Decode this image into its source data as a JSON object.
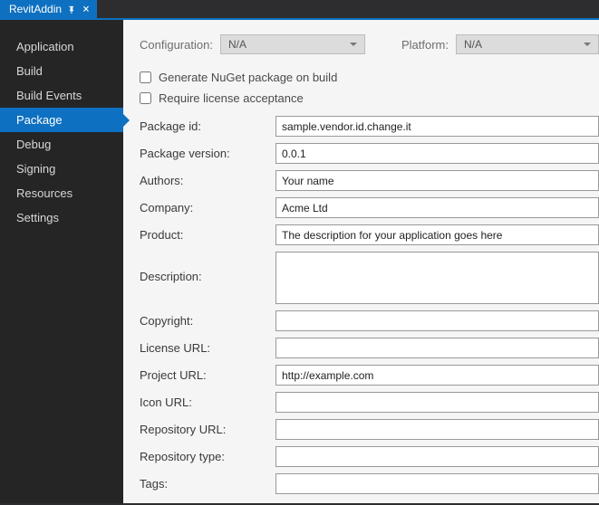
{
  "tab": {
    "title": "RevitAddin"
  },
  "sidebar": {
    "items": [
      {
        "label": "Application",
        "active": false
      },
      {
        "label": "Build",
        "active": false
      },
      {
        "label": "Build Events",
        "active": false
      },
      {
        "label": "Package",
        "active": true
      },
      {
        "label": "Debug",
        "active": false
      },
      {
        "label": "Signing",
        "active": false
      },
      {
        "label": "Resources",
        "active": false
      },
      {
        "label": "Settings",
        "active": false
      }
    ]
  },
  "config": {
    "configuration_label": "Configuration:",
    "configuration_value": "N/A",
    "platform_label": "Platform:",
    "platform_value": "N/A"
  },
  "checks": {
    "generate": "Generate NuGet package on build",
    "license": "Require license acceptance"
  },
  "fields": {
    "package_id": {
      "label": "Package id:",
      "value": "sample.vendor.id.change.it"
    },
    "package_version": {
      "label": "Package version:",
      "value": "0.0.1"
    },
    "authors": {
      "label": "Authors:",
      "value": "Your name"
    },
    "company": {
      "label": "Company:",
      "value": "Acme Ltd"
    },
    "product": {
      "label": "Product:",
      "value": "The description for your application goes here"
    },
    "description": {
      "label": "Description:",
      "value": ""
    },
    "copyright": {
      "label": "Copyright:",
      "value": ""
    },
    "license_url": {
      "label": "License URL:",
      "value": ""
    },
    "project_url": {
      "label": "Project URL:",
      "value": "http://example.com"
    },
    "icon_url": {
      "label": "Icon URL:",
      "value": ""
    },
    "repository_url": {
      "label": "Repository URL:",
      "value": ""
    },
    "repository_type": {
      "label": "Repository type:",
      "value": ""
    },
    "tags": {
      "label": "Tags:",
      "value": ""
    }
  }
}
